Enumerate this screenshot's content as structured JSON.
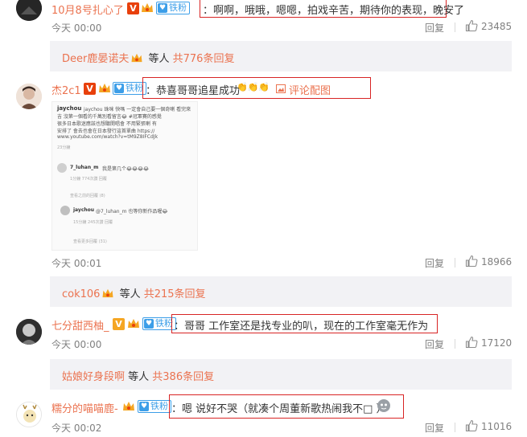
{
  "colors": {
    "username": "#eb7350",
    "highlight_border": "#d82424",
    "fan_badge": "#3c9ee8",
    "v_badge": "#e8400c",
    "reply_bar_bg": "#f2f2f5",
    "meta_text": "#808080"
  },
  "comments": [
    {
      "username": "10月8号扎心了",
      "fan_badge": "铁粉",
      "text": "：啊啊，哦哦，嗯嗯，拍戏辛苦，期待你的表现，晚安了",
      "time": "今天 00:00",
      "reply_label": "回复",
      "like_icon": "thumbs-up-icon",
      "likes": "23485"
    },
    {
      "username": "杰2c1",
      "fan_badge": "铁粉",
      "text": "：恭喜哥哥追星成功",
      "emoji": "👏👏👏",
      "pic_link": "评论配图",
      "time": "今天 00:01",
      "reply_label": "回复",
      "like_icon": "thumbs-up-icon",
      "likes": "18966",
      "embedded_screenshot": {
        "post_author": "jaychou",
        "post_text": [
          "jaychou 珠咪 快嗎 一定會自己要一個奇喇 看完來",
          "吉 沒第一個看的千萬別看留言😂 #冠軍賽的感覺",
          "很多日本歌迷應該也想聽開唱會 不用緊張喇 有",
          "安排了 會去也會在日本發行這首單曲 https://",
          "www.youtube.com/watch?v=tM9Z8IFCdJk"
        ],
        "post_age": "23分鐘",
        "reply1_user": "7_luhan_m",
        "reply1_text": "我是第几个😂😂😂😂",
        "reply1_meta": "1分鐘  774次讚  回覆",
        "view_replies": "查看之前的回覆 (8)",
        "reply2_user": "jaychou",
        "reply2_text": "@7_luhan_m 也等你新作品喔😂",
        "reply2_meta": "15分鐘  245次讚  回覆",
        "more_replies": "查看更多回覆 (31)"
      }
    },
    {
      "username": "七分甜西柚_",
      "fan_badge": "铁粉",
      "text": "：哥哥 工作室还是找专业的叭，现在的工作室毫无作为",
      "time": "今天 00:00",
      "reply_label": "回复",
      "like_icon": "thumbs-up-icon",
      "likes": "17120"
    },
    {
      "username": "糯分的喵喵鹿-",
      "fan_badge": "铁粉",
      "text": "：嗯 说好不哭（就凑个周董新歌热闹我不□ ）",
      "time": "今天 00:02",
      "reply_label": "回复",
      "like_icon": "thumbs-up-icon",
      "likes": "11016"
    }
  ],
  "reply_bars": [
    {
      "user": "Deer鹿晏诺夫",
      "mid": " 等人 ",
      "count": "共776条回复"
    },
    {
      "user": "cok106",
      "mid": " 等人 ",
      "count": "共215条回复"
    },
    {
      "user": "姑娘好身段啊",
      "mid": " 等人 ",
      "count": "共386条回复"
    }
  ]
}
